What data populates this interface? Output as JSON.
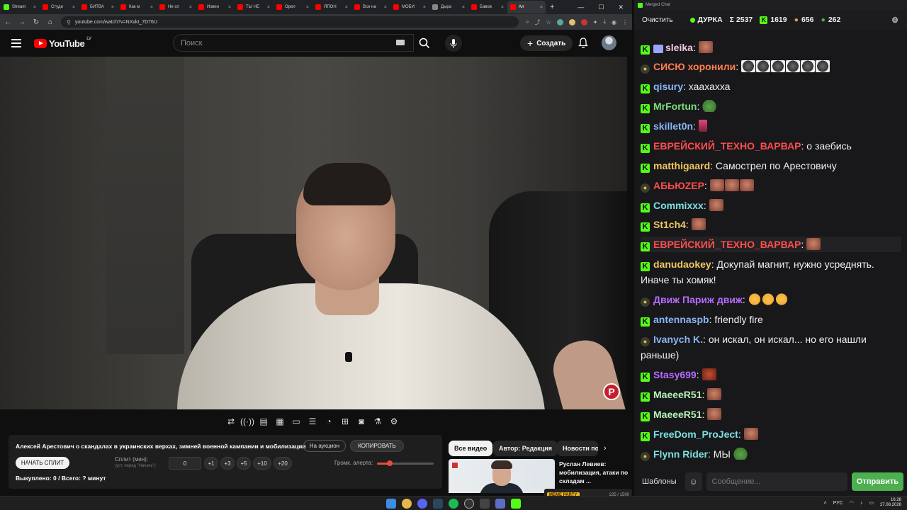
{
  "browser": {
    "tabs": [
      {
        "label": "Stream",
        "color": "#53fc18"
      },
      {
        "label": "Студи",
        "color": "#ff0000"
      },
      {
        "label": "БИТВА",
        "color": "#ff0000"
      },
      {
        "label": "Как м",
        "color": "#ff0000"
      },
      {
        "label": "Не сп",
        "color": "#ff0000"
      },
      {
        "label": "Извин",
        "color": "#ff0000"
      },
      {
        "label": "ТЫ НЕ",
        "color": "#ff0000"
      },
      {
        "label": "Орел",
        "color": "#ff0000"
      },
      {
        "label": "ЯПОН",
        "color": "#ff0000"
      },
      {
        "label": "Все на",
        "color": "#ff0000"
      },
      {
        "label": "МОБИ",
        "color": "#ff0000"
      },
      {
        "label": "Дыра",
        "color": "#888888"
      },
      {
        "label": "Бавов",
        "color": "#ff0000"
      },
      {
        "label": "Ал",
        "color": "#ff0000"
      }
    ],
    "url": "youtube.com/watch?v=NXvkt_7D76U"
  },
  "youtube": {
    "logo_text": "YouTube",
    "country": "LV",
    "search_placeholder": "Поиск",
    "create_label": "Создать"
  },
  "panel": {
    "video_title": "Алексей Арестович о скандалах в украинских верхах, зимней военной кампании и мобилизации",
    "auction_label": "На аукцион",
    "copy_label": "КОПИРОВАТЬ",
    "start_split_label": "НАЧАТЬ СПЛИТ",
    "split_label": "Сплит (мин):",
    "split_hint": "(уст. перед \"Начать\")",
    "split_value": "0",
    "increments": [
      "+1",
      "+3",
      "+5",
      "+10",
      "+20"
    ],
    "volume_label": "Громк. алерта:",
    "volume_level": 0.22,
    "stats": "Выкуплено: 0 / Всего: ? минут"
  },
  "chips": {
    "all": "Все видео",
    "author": "Автор: Редакция",
    "news": "Новости по"
  },
  "recommendation": {
    "title": "Руслан Левиев: мобилизация, атаки по складам ..."
  },
  "overlay": {
    "meme_label": "MEME PARTY",
    "counter": "225 / 1500"
  },
  "chat": {
    "window_title": "Merged Chat",
    "clear_label": "Очистить",
    "channel": "ДУРКА",
    "sum": "Σ 2537",
    "kick_count": "1619",
    "other_count": "656",
    "frog_count": "262",
    "messages": [
      {
        "platform": "kick",
        "user": "sleika",
        "color": "#f2c6e0",
        "text": "",
        "emotes": [
          "face"
        ],
        "badge": true
      },
      {
        "platform": "other",
        "user": "СИСЮ хоронили",
        "color": "#ff7f50",
        "text": "",
        "emotes": [
          "dark",
          "dark",
          "dark",
          "dark",
          "dark",
          "dark"
        ]
      },
      {
        "platform": "kick",
        "user": "qisury",
        "color": "#8ab4f8",
        "text": "хаахахха",
        "emotes": []
      },
      {
        "platform": "kick",
        "user": "MrFortun",
        "color": "#7be07b",
        "text": "",
        "emotes": [
          "frog"
        ]
      },
      {
        "platform": "kick",
        "user": "skillet0n",
        "color": "#8ab4f8",
        "text": "",
        "emotes": [
          "pink"
        ]
      },
      {
        "platform": "kick",
        "user": "ЕВРЕЙСКИЙ_ТЕХНО_ВАРВАР",
        "color": "#ff4d4d",
        "text": "о заебись",
        "emotes": []
      },
      {
        "platform": "kick",
        "user": "matthigaard",
        "color": "#f0c75e",
        "text": "Самострел по Арестовичу",
        "emotes": []
      },
      {
        "platform": "other",
        "user": "АБЬЮZЕР",
        "color": "#ff4d4d",
        "text": "",
        "emotes": [
          "face",
          "face",
          "face"
        ]
      },
      {
        "platform": "kick",
        "user": "Commixxx",
        "color": "#7de0e0",
        "text": "",
        "emotes": [
          "face"
        ]
      },
      {
        "platform": "kick",
        "user": "St1ch4",
        "color": "#f0c75e",
        "text": "",
        "emotes": [
          "face"
        ]
      },
      {
        "platform": "kick",
        "user": "ЕВРЕЙСКИЙ_ТЕХНО_ВАРВАР",
        "color": "#ff4d4d",
        "text": "",
        "emotes": [
          "face"
        ],
        "highlight": true
      },
      {
        "platform": "kick",
        "user": "danudaokey",
        "color": "#f0c75e",
        "text": "Докупай магнит, нужно усреднять. Иначе ты хомяк!",
        "emotes": []
      },
      {
        "platform": "other",
        "user": "Движ Париж движ",
        "color": "#b86bff",
        "text": "",
        "emotes": [
          "laugh",
          "laugh",
          "laugh"
        ]
      },
      {
        "platform": "kick",
        "user": "antennaspb",
        "color": "#8ab4f8",
        "text": "friendly fire",
        "emotes": []
      },
      {
        "platform": "other",
        "user": "Ivanych K.",
        "color": "#8ab4f8",
        "text": "он искал, он искал... но его нашли раньше)",
        "emotes": []
      },
      {
        "platform": "kick",
        "user": "Stasy699",
        "color": "#b86bff",
        "text": "",
        "emotes": [
          "rage"
        ]
      },
      {
        "platform": "kick",
        "user": "MaeeeR51",
        "color": "#b5f2b5",
        "text": "",
        "emotes": [
          "face"
        ]
      },
      {
        "platform": "kick",
        "user": "MaeeeR51",
        "color": "#b5f2b5",
        "text": "",
        "emotes": [
          "face"
        ]
      },
      {
        "platform": "kick",
        "user": "FreeDom_ProJect",
        "color": "#7de0e0",
        "text": "",
        "emotes": [
          "face"
        ]
      },
      {
        "platform": "other",
        "user": "Flynn Rider",
        "color": "#7de0e0",
        "text": "МЫ",
        "emotes": [
          "frog"
        ]
      }
    ],
    "templates_label": "Шаблоны",
    "input_placeholder": "Сообщение...",
    "send_label": "Отправить"
  },
  "taskbar": {
    "lang": "РУС",
    "time": "16:28",
    "date": "27.08.2026"
  }
}
